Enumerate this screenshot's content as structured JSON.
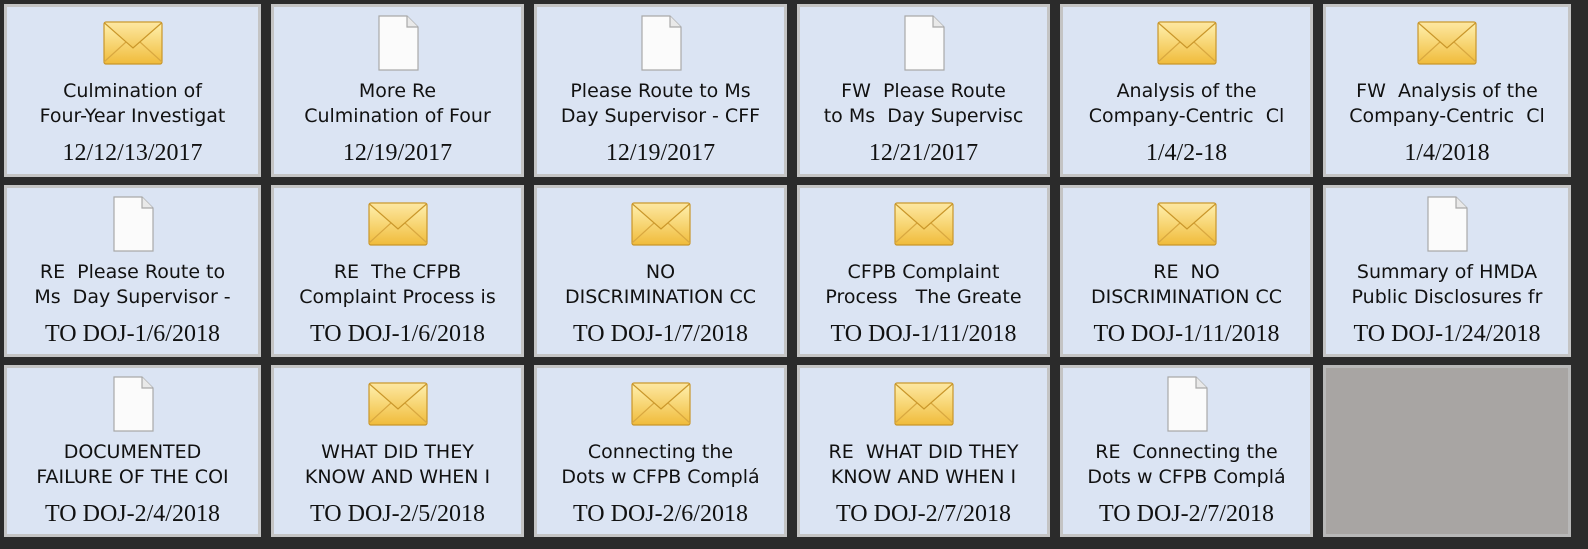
{
  "colors": {
    "tile_bg": "#dbe4f3",
    "tile_border": "#c4c4c4",
    "empty_tile_bg": "#a8a5a3",
    "window_bg": "#2b2b2b",
    "envelope_fill": "#f5cf5a"
  },
  "tiles": [
    {
      "icon": "envelope-icon",
      "line1": "Culmination of",
      "line2": "Four-Year Investigat",
      "date": "12/12/13/2017"
    },
    {
      "icon": "document-icon",
      "line1": "More Re",
      "line2": "Culmination of Four",
      "date": "12/19/2017"
    },
    {
      "icon": "document-icon",
      "line1": "Please Route to Ms",
      "line2": "Day Supervisor - CFF",
      "date": "12/19/2017"
    },
    {
      "icon": "document-icon",
      "line1": "FW  Please Route",
      "line2": "to Ms  Day Supervisc",
      "date": "12/21/2017"
    },
    {
      "icon": "envelope-icon",
      "line1": "Analysis of the",
      "line2": "Company-Centric  Cl",
      "date": "1/4/2-18"
    },
    {
      "icon": "envelope-icon",
      "line1": "FW  Analysis of the",
      "line2": "Company-Centric  Cl",
      "date": "1/4/2018"
    },
    {
      "icon": "document-icon",
      "line1": "RE  Please Route to",
      "line2": "Ms  Day Supervisor -",
      "date": "TO DOJ-1/6/2018"
    },
    {
      "icon": "envelope-icon",
      "line1": "RE  The CFPB",
      "line2": "Complaint Process is",
      "date": "TO DOJ-1/6/2018"
    },
    {
      "icon": "envelope-icon",
      "line1": "NO",
      "line2": "DISCRIMINATION CC",
      "date": "TO DOJ-1/7/2018"
    },
    {
      "icon": "envelope-icon",
      "line1": "CFPB Complaint",
      "line2": "Process   The Greate",
      "date": "TO DOJ-1/11/2018"
    },
    {
      "icon": "envelope-icon",
      "line1": "RE  NO",
      "line2": "DISCRIMINATION CC",
      "date": "TO DOJ-1/11/2018"
    },
    {
      "icon": "document-icon",
      "line1": "Summary of HMDA",
      "line2": "Public Disclosures fr",
      "date": "TO DOJ-1/24/2018"
    },
    {
      "icon": "document-icon",
      "line1": "DOCUMENTED",
      "line2": "FAILURE OF THE COI",
      "date": "TO DOJ-2/4/2018"
    },
    {
      "icon": "envelope-icon",
      "line1": "WHAT DID THEY",
      "line2": "KNOW AND WHEN I",
      "date": "TO DOJ-2/5/2018"
    },
    {
      "icon": "envelope-icon",
      "line1": "Connecting the",
      "line2": "Dots w CFPB Complá",
      "date": "TO DOJ-2/6/2018"
    },
    {
      "icon": "envelope-icon",
      "line1": "RE  WHAT DID THEY",
      "line2": "KNOW AND WHEN I",
      "date": "TO DOJ-2/7/2018"
    },
    {
      "icon": "document-icon",
      "line1": "RE  Connecting the",
      "line2": "Dots w CFPB Complá",
      "date": "TO DOJ-2/7/2018"
    }
  ]
}
